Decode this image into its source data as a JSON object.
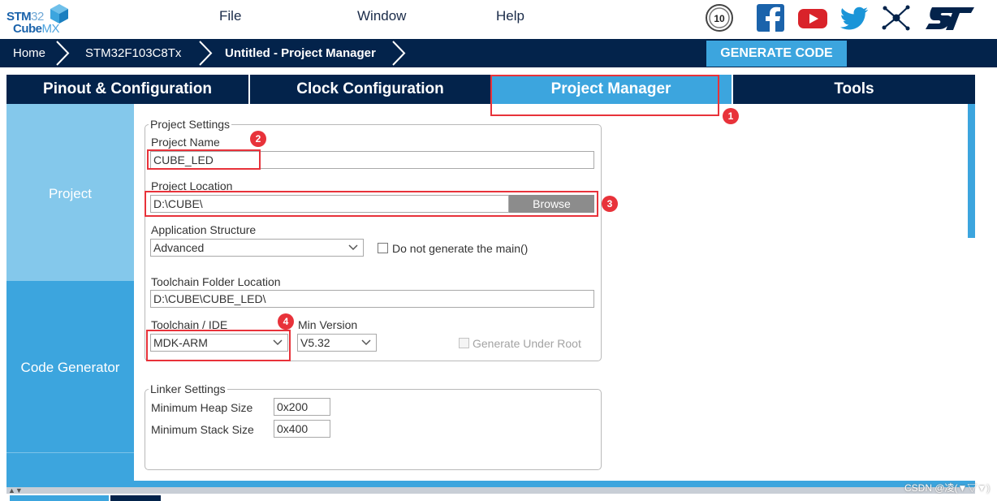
{
  "app": {
    "logo_top_bold": "STM",
    "logo_top_thin": "32",
    "logo_bottom_bold": "Cube",
    "logo_bottom_thin": "MX"
  },
  "menu": {
    "file": "File",
    "window": "Window",
    "help": "Help"
  },
  "social": {
    "anniversary_badge": "10",
    "icons": [
      "anniversary-icon",
      "facebook-icon",
      "youtube-icon",
      "twitter-icon",
      "network-icon",
      "st-logo-icon"
    ],
    "st_logo_text": "ST"
  },
  "breadcrumb": {
    "home": "Home",
    "mcu": "STM32F103C8Tx",
    "current": "Untitled - Project Manager"
  },
  "toolbar": {
    "generate_code": "GENERATE CODE"
  },
  "tabs": [
    {
      "label": "Pinout & Configuration"
    },
    {
      "label": "Clock Configuration"
    },
    {
      "label": "Project Manager"
    },
    {
      "label": "Tools"
    }
  ],
  "leftnav": {
    "project": "Project",
    "code_generator": "Code Generator"
  },
  "project_settings": {
    "legend": "Project Settings",
    "project_name_label": "Project Name",
    "project_name_value": "CUBE_LED",
    "project_location_label": "Project Location",
    "project_location_value": "D:\\CUBE\\",
    "browse_label": "Browse",
    "app_structure_label": "Application Structure",
    "app_structure_value": "Advanced",
    "do_not_generate_main_label": "Do not generate the main()",
    "toolchain_folder_label": "Toolchain Folder Location",
    "toolchain_folder_value": "D:\\CUBE\\CUBE_LED\\",
    "toolchain_ide_label": "Toolchain / IDE",
    "toolchain_ide_value": "MDK-ARM",
    "min_version_label": "Min Version",
    "min_version_value": "V5.32",
    "generate_under_root_label": "Generate Under Root"
  },
  "linker_settings": {
    "legend": "Linker Settings",
    "min_heap_label": "Minimum Heap Size",
    "min_heap_value": "0x200",
    "min_stack_label": "Minimum Stack Size",
    "min_stack_value": "0x400"
  },
  "annotations": {
    "badge1": "1",
    "badge2": "2",
    "badge3": "3",
    "badge4": "4",
    "color": "#e8323a"
  },
  "watermark": "CSDN @凌(▼▽▼)",
  "colors": {
    "navy": "#03234b",
    "accent_blue": "#3ca5de",
    "light_blue": "#84c8eb"
  }
}
